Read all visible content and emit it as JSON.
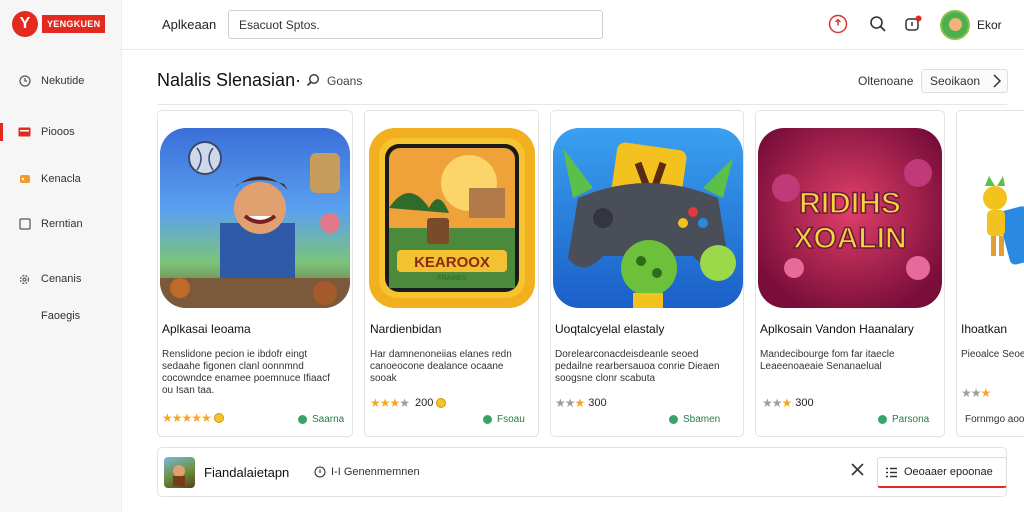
{
  "brand": {
    "mark": "Y",
    "name": "YENGKUEN"
  },
  "sidebar": {
    "items": [
      {
        "label": "Nekutide"
      },
      {
        "label": "Piooos"
      },
      {
        "label": "Kenacla"
      },
      {
        "label": "Rerntian"
      },
      {
        "label": "Cenanis"
      }
    ],
    "sub_label": "Faoegis"
  },
  "header": {
    "app_title": "Aplkeaan",
    "search_value": "Esacuot Sptos.",
    "user_name": "Ekor"
  },
  "section": {
    "title": "Nalalis Slenasian·",
    "search_label": "Goans",
    "link_label": "Oltenoane",
    "button_label": "Seoikaon"
  },
  "cards": [
    {
      "title": "Aplkasai Ieoama",
      "desc": "Renslidone pecion ie ibdofr eingt sedaahe figonen clanl oonnmnd cocowndce enamee poemnuce Ifiaacf ou Isan taa.",
      "rating_text": "",
      "tag": "Saarna"
    },
    {
      "title": "Nardienbidan",
      "desc": "Har damnenoneiias elanes redn canoeocone dealance ocaane sooak",
      "rating_text": "200",
      "tag": "Fsoau"
    },
    {
      "title": "Uoqtalcyelal elastaly",
      "desc": "Dorelearconacdeisdeanle seoed pedailne rearbersauoa conrie Dieaen soogsne clonr scabuta",
      "rating_text": "300",
      "tag": "Sbamen"
    },
    {
      "title": "Aplkosain Vandon Haanalary",
      "desc": "Mandecibourge fom far itaecle Leaeenoaeaie Senanaelual",
      "rating_text": "300",
      "tag": "Parsona"
    },
    {
      "title": "Ihoatkan",
      "desc": "Pieoalce Seoeoeu",
      "rating_text": "",
      "tag": "Fornmgo aoosa"
    }
  ],
  "bottom": {
    "title": "Fiandalaietapn",
    "meta": "I-I Genenmemnen",
    "button_label": "Oeoaaer epoonae"
  },
  "colors": {
    "accent": "#e22a1e",
    "star": "#f5a623",
    "tag_green": "#3aa468"
  }
}
